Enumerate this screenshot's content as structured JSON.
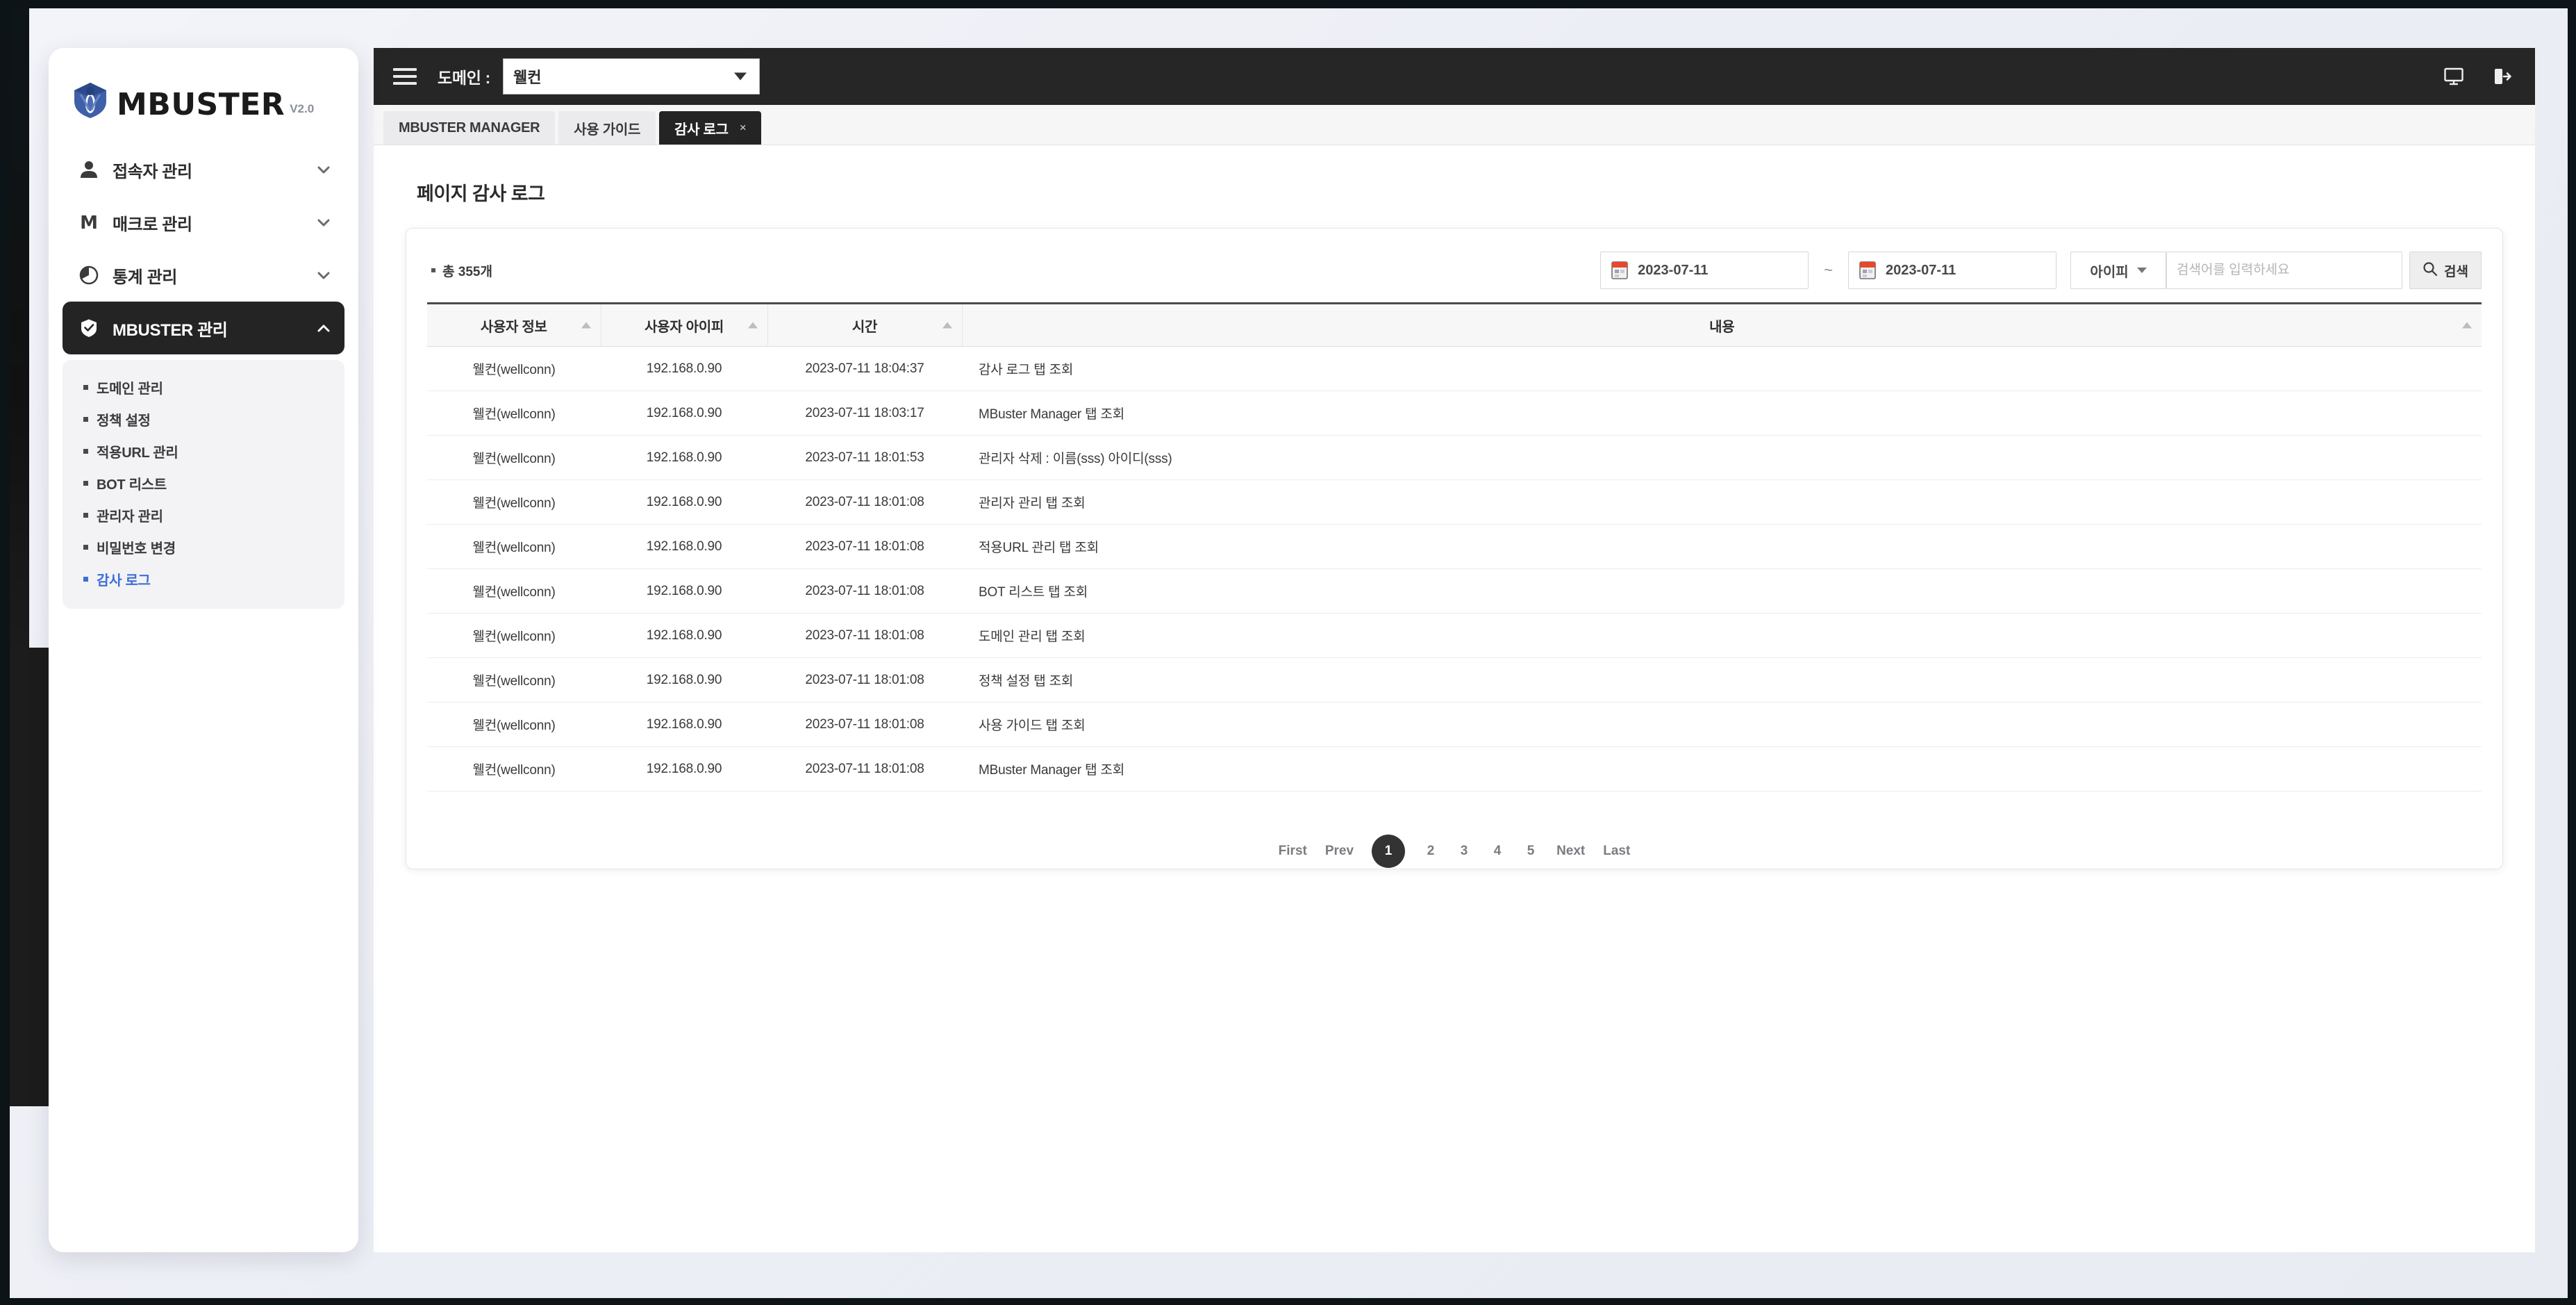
{
  "brand": {
    "name": "MBUSTER",
    "version": "V2.0",
    "logo_icon": "shield-bug-icon"
  },
  "sidebar": {
    "items": [
      {
        "label": "접속자 관리",
        "icon": "person-icon",
        "chevron": "chevron-down-icon",
        "active": false
      },
      {
        "label": "매크로 관리",
        "icon": "letter-m-icon",
        "chevron": "chevron-down-icon",
        "active": false
      },
      {
        "label": "통계 관리",
        "icon": "pie-chart-icon",
        "chevron": "chevron-down-icon",
        "active": false
      },
      {
        "label": "MBUSTER 관리",
        "icon": "shield-check-icon",
        "chevron": "chevron-up-icon",
        "active": true
      }
    ],
    "submenu": [
      {
        "label": "도메인 관리",
        "selected": false
      },
      {
        "label": "정책 설정",
        "selected": false
      },
      {
        "label": "적용URL 관리",
        "selected": false
      },
      {
        "label": "BOT 리스트",
        "selected": false
      },
      {
        "label": "관리자 관리",
        "selected": false
      },
      {
        "label": "비밀번호 변경",
        "selected": false
      },
      {
        "label": "감사 로그",
        "selected": true
      }
    ]
  },
  "topbar": {
    "menu_icon": "hamburger-icon",
    "domain_label": "도메인 :",
    "domain_value": "웰컨",
    "monitor_icon": "monitor-icon",
    "logout_icon": "logout-icon"
  },
  "tabs": [
    {
      "label": "MBUSTER MANAGER",
      "active": false,
      "closable": false
    },
    {
      "label": "사용 가이드",
      "active": false,
      "closable": false
    },
    {
      "label": "감사 로그",
      "active": true,
      "closable": true,
      "close_label": "×"
    }
  ],
  "page": {
    "title": "페이지 감사 로그",
    "total_text": "총 355개"
  },
  "filters": {
    "date_from": "2023-07-11",
    "date_to": "2023-07-11",
    "date_separator": "~",
    "calendar_icon": "calendar-icon",
    "search_field_value": "아이피",
    "search_placeholder": "검색어를 입력하세요",
    "search_input_value": "",
    "search_button_label": "검색",
    "search_button_icon": "magnifier-icon"
  },
  "table": {
    "columns": [
      "사용자 정보",
      "사용자 아이피",
      "시간",
      "내용"
    ],
    "rows": [
      {
        "user": "웰컨(wellconn)",
        "ip": "192.168.0.90",
        "time": "2023-07-11 18:04:37",
        "content": "감사 로그 탭 조회"
      },
      {
        "user": "웰컨(wellconn)",
        "ip": "192.168.0.90",
        "time": "2023-07-11 18:03:17",
        "content": "MBuster Manager 탭 조회"
      },
      {
        "user": "웰컨(wellconn)",
        "ip": "192.168.0.90",
        "time": "2023-07-11 18:01:53",
        "content": "관리자 삭제 : 이름(sss) 아이디(sss)"
      },
      {
        "user": "웰컨(wellconn)",
        "ip": "192.168.0.90",
        "time": "2023-07-11 18:01:08",
        "content": "관리자 관리 탭 조회"
      },
      {
        "user": "웰컨(wellconn)",
        "ip": "192.168.0.90",
        "time": "2023-07-11 18:01:08",
        "content": "적용URL 관리 탭 조회"
      },
      {
        "user": "웰컨(wellconn)",
        "ip": "192.168.0.90",
        "time": "2023-07-11 18:01:08",
        "content": "BOT 리스트 탭 조회"
      },
      {
        "user": "웰컨(wellconn)",
        "ip": "192.168.0.90",
        "time": "2023-07-11 18:01:08",
        "content": "도메인 관리 탭 조회"
      },
      {
        "user": "웰컨(wellconn)",
        "ip": "192.168.0.90",
        "time": "2023-07-11 18:01:08",
        "content": "정책 설정 탭 조회"
      },
      {
        "user": "웰컨(wellconn)",
        "ip": "192.168.0.90",
        "time": "2023-07-11 18:01:08",
        "content": "사용 가이드 탭 조회"
      },
      {
        "user": "웰컨(wellconn)",
        "ip": "192.168.0.90",
        "time": "2023-07-11 18:01:08",
        "content": "MBuster Manager 탭 조회"
      }
    ]
  },
  "pagination": {
    "first": "First",
    "prev": "Prev",
    "pages": [
      "1",
      "2",
      "3",
      "4",
      "5"
    ],
    "current": "1",
    "next": "Next",
    "last": "Last"
  },
  "colors": {
    "accent_blue": "#3d6fd6",
    "active_dark": "#242424",
    "topbar": "#262626",
    "page_bg": "#eceef5"
  }
}
